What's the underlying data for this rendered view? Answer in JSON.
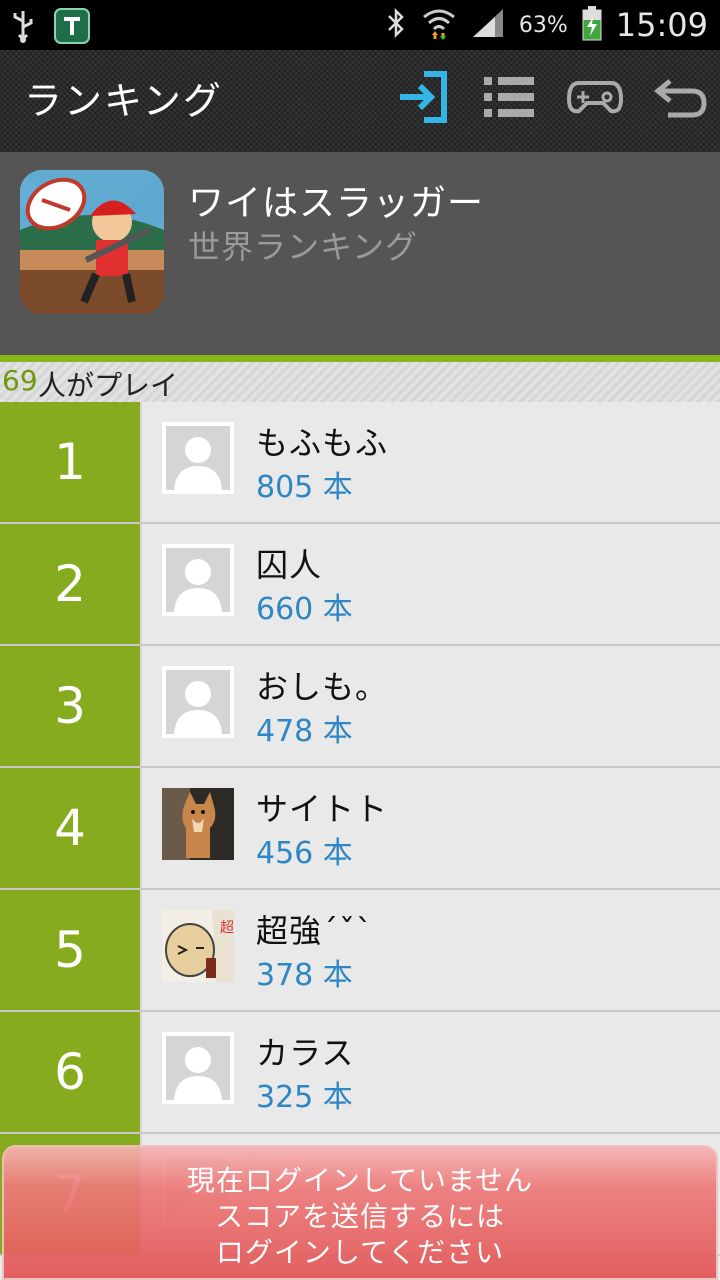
{
  "status_bar": {
    "battery_percent": "63%",
    "time": "15:09",
    "icons": [
      "usb-icon",
      "app-notification-icon",
      "bluetooth-icon",
      "wifi-icon",
      "signal-icon",
      "battery-charging-icon"
    ]
  },
  "action_bar": {
    "title": "ランキング",
    "icons": [
      "login-icon",
      "list-icon",
      "gamepad-icon",
      "back-icon"
    ],
    "accent_color": "#33b5e5"
  },
  "game": {
    "title": "ワイはスラッガー",
    "subtitle": "世界ランキング"
  },
  "players": {
    "count": "69",
    "label": "人がプレイ"
  },
  "ranking": [
    {
      "rank": "1",
      "name": "もふもふ",
      "score": "805 本",
      "avatar": "default-avatar"
    },
    {
      "rank": "2",
      "name": "囚人",
      "score": "660 本",
      "avatar": "default-avatar"
    },
    {
      "rank": "3",
      "name": "おしも。",
      "score": "478 本",
      "avatar": "default-avatar"
    },
    {
      "rank": "4",
      "name": "サイトト",
      "score": "456 本",
      "avatar": "dog-photo"
    },
    {
      "rank": "5",
      "name": "超強´ˇ`",
      "score": "378 本",
      "avatar": "character-illustration"
    },
    {
      "rank": "6",
      "name": "カラス",
      "score": "325 本",
      "avatar": "default-avatar"
    },
    {
      "rank": "7",
      "name": "",
      "score": "",
      "avatar": "default-avatar"
    }
  ],
  "toast": {
    "line1": "現在ログインしていません",
    "line2": "スコアを送信するには",
    "line3": "ログインしてください"
  },
  "colors": {
    "rank_green": "#86ab1e",
    "score_blue": "#2f86c4",
    "toast_red": "#e25656"
  }
}
